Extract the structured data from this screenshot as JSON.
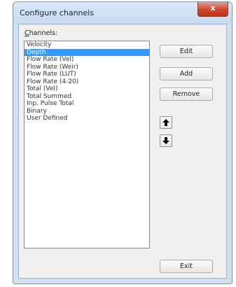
{
  "window": {
    "title": "Configure channels",
    "close_glyph": "x"
  },
  "channels": {
    "label_prefix": "C",
    "label_rest": "hannels:",
    "selected_index": 1,
    "items": [
      {
        "label": "Velocity"
      },
      {
        "label": "Depth"
      },
      {
        "label": "Flow Rate (Vel)"
      },
      {
        "label": "Flow Rate (Weir)"
      },
      {
        "label": "Flow Rate (LUT)"
      },
      {
        "label": "Flow Rate (4-20)"
      },
      {
        "label": "Total (Vel)"
      },
      {
        "label": "Total Summed"
      },
      {
        "label": "Inp. Pulse Total"
      },
      {
        "label": "Binary"
      },
      {
        "label": "User Defined"
      }
    ]
  },
  "buttons": {
    "edit": "Edit",
    "add": "Add",
    "remove": "Remove",
    "exit": "Exit",
    "move_up_icon": "arrow-up-icon",
    "move_down_icon": "arrow-down-icon"
  },
  "colors": {
    "selection": "#3399ff",
    "close_button": "#c8452c"
  }
}
